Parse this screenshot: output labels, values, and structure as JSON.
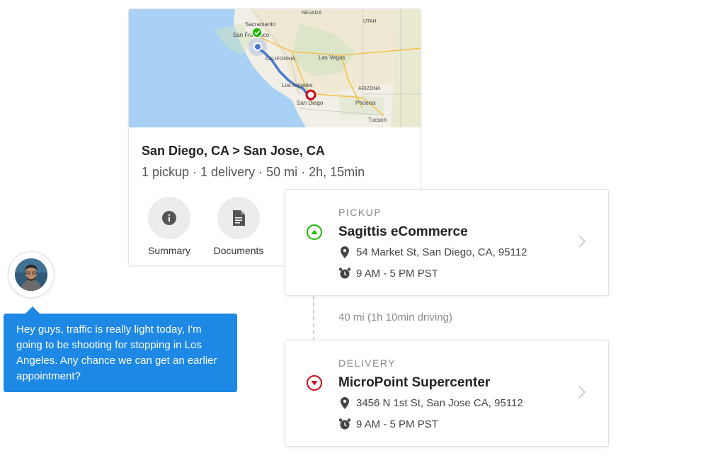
{
  "route": {
    "title": "San Diego, CA > San Jose, CA",
    "subtitle": "1 pickup · 1 delivery · 50 mi · 2h, 15min",
    "actions": [
      {
        "label": "Summary",
        "icon": "info-icon"
      },
      {
        "label": "Documents",
        "icon": "document-icon"
      }
    ],
    "map": {
      "labels": {
        "nevada": "NEVADA",
        "utah": "UTAH",
        "sacramento": "Sacramento",
        "san_francisco": "San Francisco",
        "california": "CALIFORNIA",
        "las_vegas": "Las Vegas",
        "los_angeles": "Los Angeles",
        "arizona": "ARIZONA",
        "phoenix": "Phoenix",
        "san_diego": "San Diego",
        "tucson": "Tucson"
      },
      "colors": {
        "water": "#a8d1f5",
        "land": "#f2efe6",
        "route": "#4a78d0",
        "pickup": "#1fb800",
        "delivery": "#d0021b"
      }
    }
  },
  "chat": {
    "message": "Hey guys, traffic is really light today, I'm going to be shooting for stopping in Los Angeles. Any chance we can get an earlier appointment?",
    "bubble_color": "#1e88e5"
  },
  "stops": {
    "pickup": {
      "type": "PICKUP",
      "name": "Sagittis eCommerce",
      "address": "54 Market St, San Diego, CA, 95112",
      "hours": "9 AM - 5 PM PST",
      "color": "#1fb800"
    },
    "leg": "40 mi (1h 10min driving)",
    "delivery": {
      "type": "DELIVERY",
      "name": "MicroPoint Supercenter",
      "address": "3456 N 1st St, San Jose CA, 95112",
      "hours": "9 AM - 5 PM PST",
      "color": "#d0021b"
    }
  }
}
